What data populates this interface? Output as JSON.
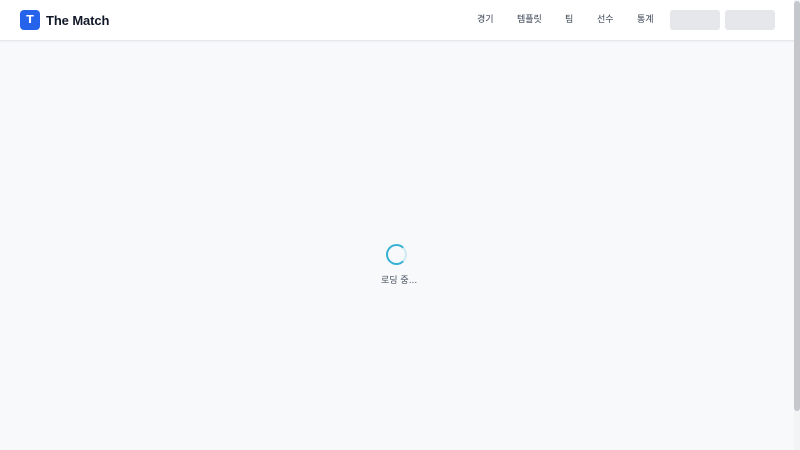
{
  "header": {
    "brand": {
      "badge_letter": "T",
      "name": "The Match",
      "badge_color": "#2563eb"
    },
    "nav": [
      {
        "label": "경기"
      },
      {
        "label": "템플릿"
      },
      {
        "label": "팀"
      },
      {
        "label": "선수"
      },
      {
        "label": "통계"
      }
    ]
  },
  "main": {
    "loading_text": "로딩 중...",
    "spinner_color": "#38b2d4"
  },
  "colors": {
    "page_background": "#f8f9fb",
    "header_background": "#ffffff",
    "placeholder": "#e5e7eb"
  }
}
